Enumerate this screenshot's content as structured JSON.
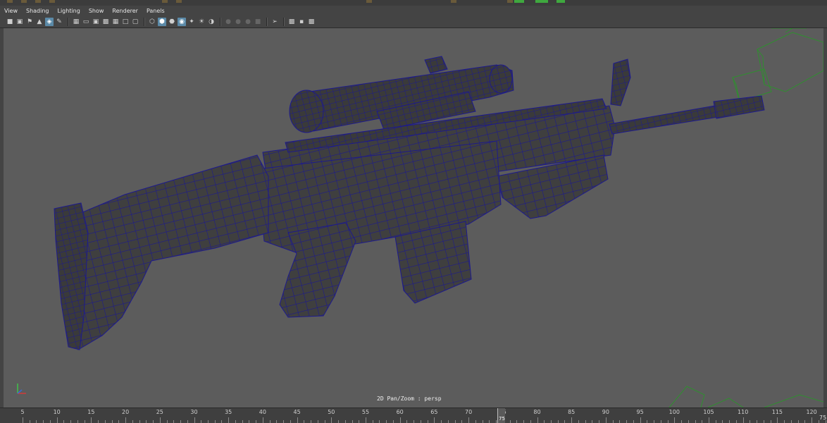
{
  "menu": {
    "items": [
      "View",
      "Shading",
      "Lighting",
      "Show",
      "Renderer",
      "Panels"
    ]
  },
  "toolbar": {
    "icons": [
      "camera-icon",
      "camera-attributes-icon",
      "bookmark-icon",
      "image-plane-icon",
      "grid-lock-icon",
      "pencil-icon",
      "grid-icon",
      "film-gate-icon",
      "resolution-gate-icon",
      "gate-mask-icon",
      "field-chart-icon",
      "safe-action-icon",
      "safe-title-icon",
      "wireframe-icon",
      "smooth-shade-icon",
      "wireframe-on-shaded-icon",
      "textured-icon",
      "lights-icon",
      "shadows-icon",
      "xray-icon",
      "ambient-occlusion-icon",
      "motion-blur-icon",
      "antialias-icon",
      "depth-of-field-icon",
      "isolate-select-icon",
      "xray-joints-icon",
      "xray-components-icon",
      "hud-icon"
    ]
  },
  "viewport": {
    "hud_text": "2D Pan/Zoom : persp",
    "wireframe_color": "#1d1a8c",
    "mesh_color": "#3d3d3d",
    "background_color": "#5c5c5c",
    "axis_labels": {
      "x": "x",
      "y": "y",
      "z": "z"
    }
  },
  "timeline": {
    "labels": [
      "5",
      "10",
      "15",
      "20",
      "25",
      "30",
      "35",
      "40",
      "45",
      "50",
      "55",
      "60",
      "65",
      "70",
      "75",
      "80",
      "85",
      "90",
      "95",
      "100",
      "105",
      "110",
      "115",
      "120"
    ],
    "cursor_label": "75",
    "current_frame": "75"
  }
}
